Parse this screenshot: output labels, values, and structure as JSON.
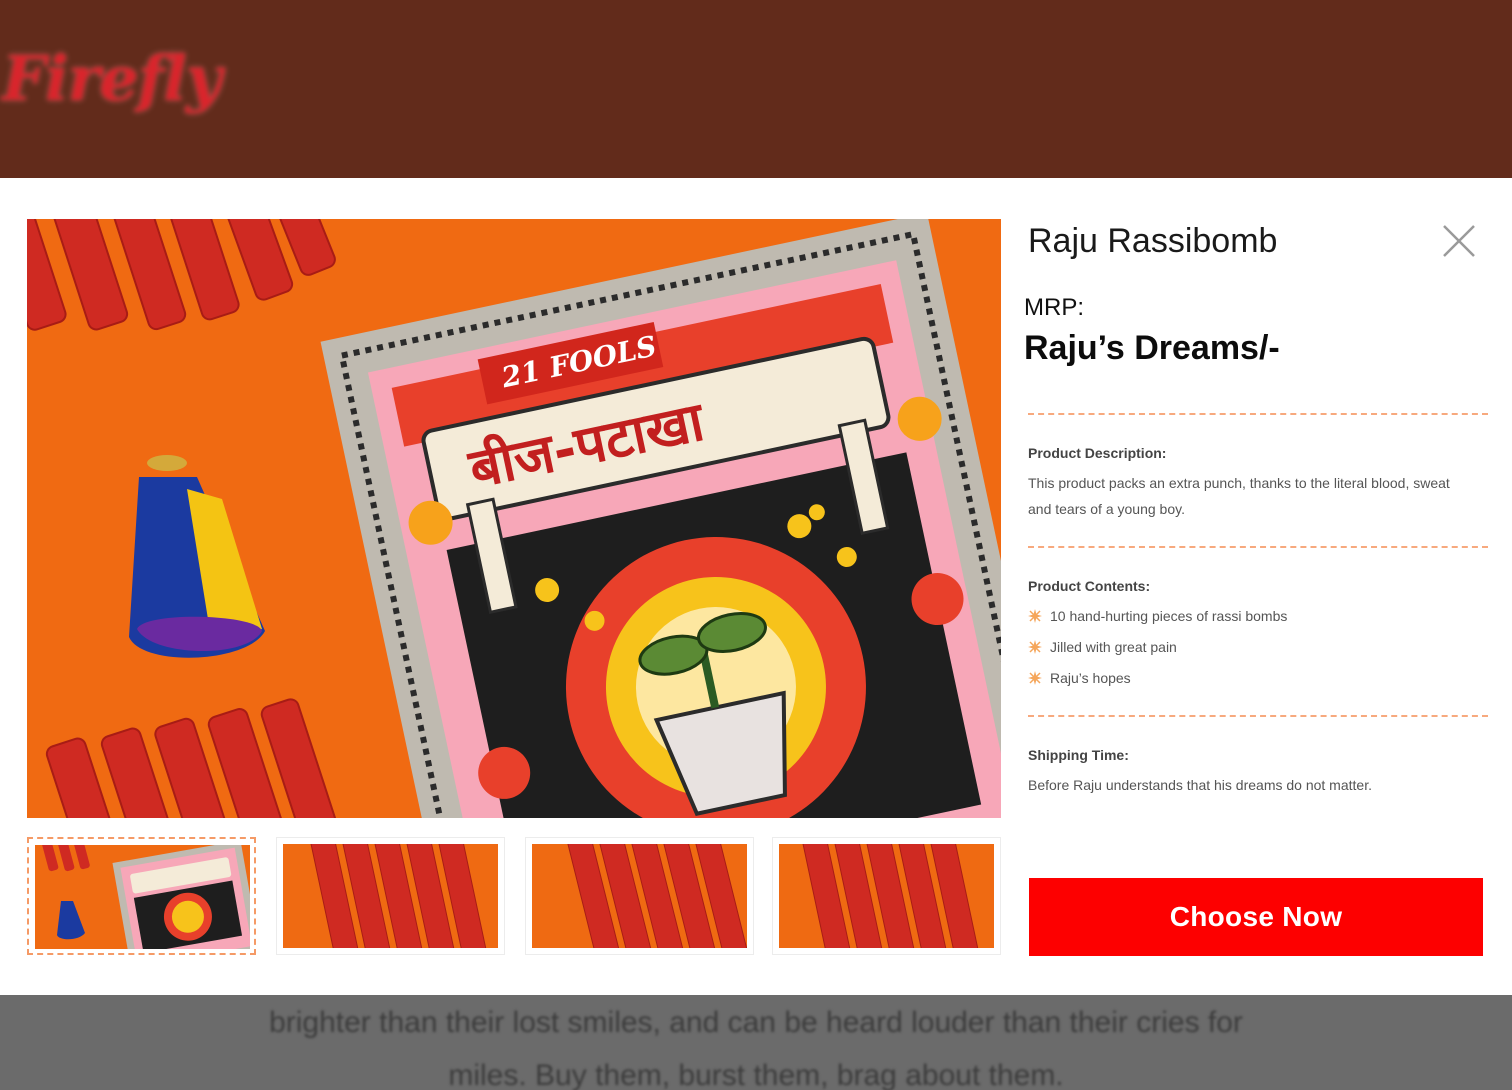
{
  "background": {
    "logo_text": "Firefly",
    "text_line1": "brighter than their lost smiles, and can be heard louder than their cries for",
    "text_line2": "miles. Buy them, burst them, brag about them."
  },
  "modal": {
    "product_name": "Raju Rassibomb",
    "mrp_label": "MRP:",
    "mrp_value": "Raju’s Dreams/-",
    "description_heading": "Product Description:",
    "description_text": "This product packs an extra punch, thanks to the literal blood, sweat and tears of a young boy.",
    "contents_heading": "Product Contents:",
    "contents": [
      "10 hand-hurting pieces of rassi bombs",
      "Jilled with great pain",
      "Raju’s hopes"
    ],
    "shipping_heading": "Shipping Time:",
    "shipping_text": "Before Raju understands that his dreams do not matter.",
    "cta_label": "Choose Now",
    "close_icon": "close-icon",
    "bullet_icon": "sparkle-icon",
    "image_box_brand": "21 FOOLS",
    "image_box_title": "बीज-पटाखा",
    "thumbnail_count": 4,
    "active_thumbnail": 1
  },
  "colors": {
    "header_bg": "#622b1b",
    "accent_red": "#fd0000",
    "divider": "#f7a97e",
    "image_orange": "#f06a12"
  }
}
